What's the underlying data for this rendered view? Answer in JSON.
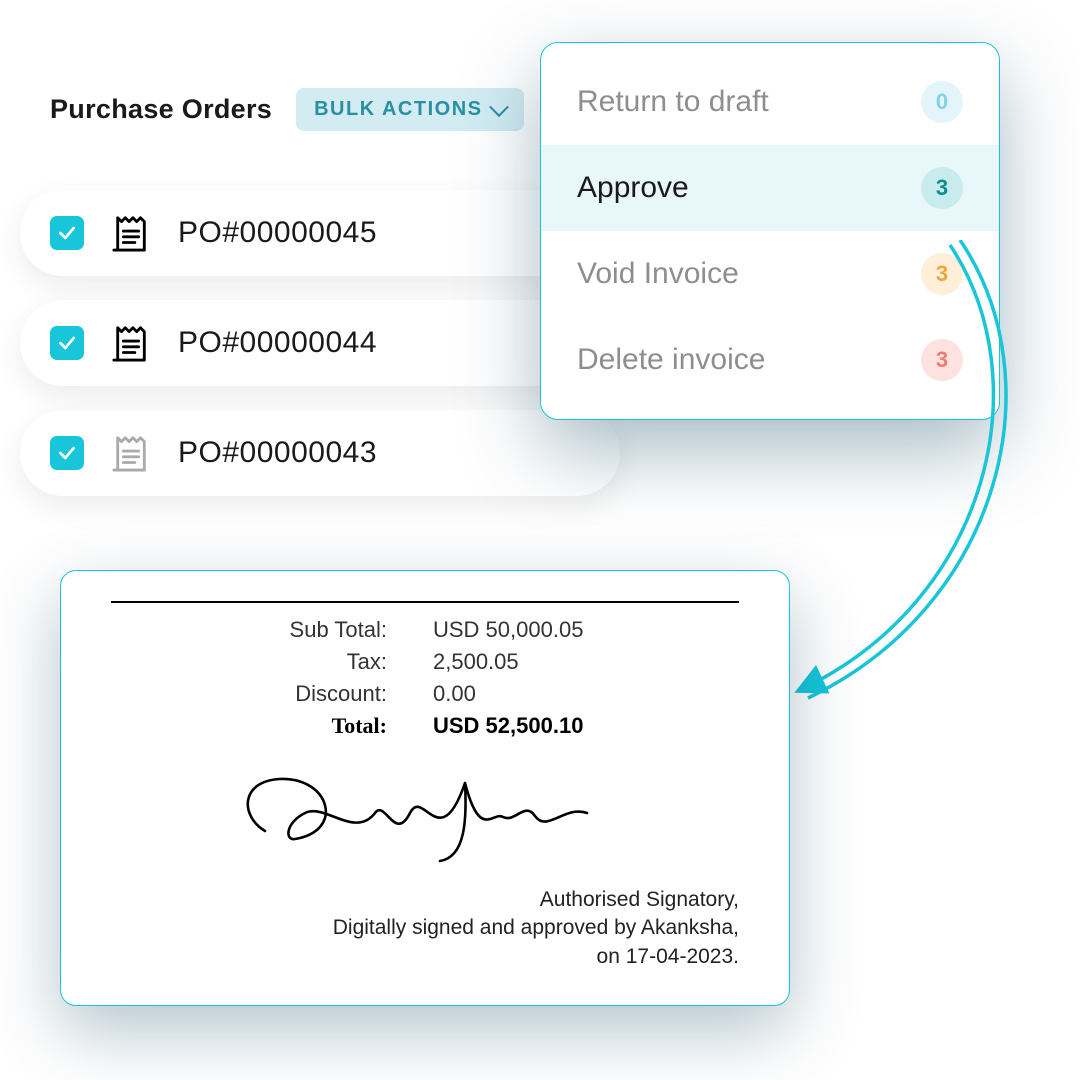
{
  "header": {
    "title": "Purchase Orders",
    "bulk_actions_label": "BULK ACTIONS"
  },
  "po_list": [
    {
      "label": "PO#00000045",
      "checked": true,
      "muted": false
    },
    {
      "label": "PO#00000044",
      "checked": true,
      "muted": false
    },
    {
      "label": "PO#00000043",
      "checked": true,
      "muted": true
    }
  ],
  "actions_menu": [
    {
      "label": "Return to draft",
      "count": "0",
      "badge": "blue",
      "state": "muted"
    },
    {
      "label": "Approve",
      "count": "3",
      "badge": "teal",
      "state": "selected"
    },
    {
      "label": "Void Invoice",
      "count": "3",
      "badge": "amber",
      "state": "muted"
    },
    {
      "label": "Delete invoice",
      "count": "3",
      "badge": "red",
      "state": "muted"
    }
  ],
  "invoice": {
    "rows": {
      "subtotal_label": "Sub Total:",
      "subtotal_value": "USD 50,000.05",
      "tax_label": "Tax:",
      "tax_value": "2,500.05",
      "discount_label": "Discount:",
      "discount_value": "0.00",
      "total_label": "Total:",
      "total_value": "USD 52,500.10"
    },
    "signatory": {
      "line1": "Authorised Signatory,",
      "line2": "Digitally signed and approved by Akanksha,",
      "line3": "on 17-04-2023."
    }
  }
}
